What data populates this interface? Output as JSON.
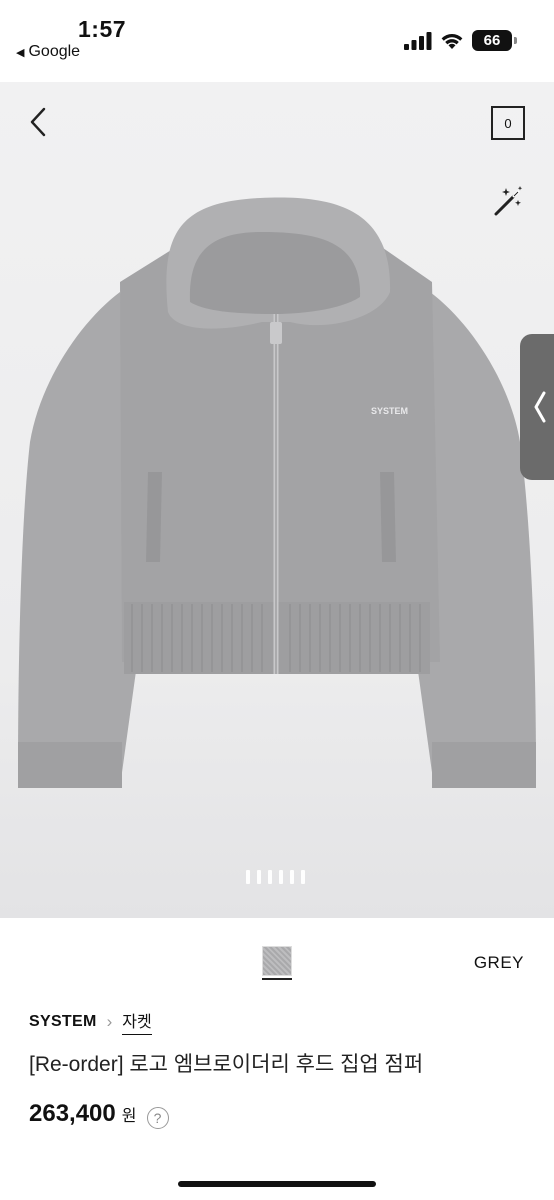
{
  "status_bar": {
    "time": "1:57",
    "back_app": "Google",
    "battery": "66"
  },
  "gallery": {
    "cart_count": "0",
    "image_alt": "Grey knit cropped zip-up hoodie with SYSTEM embroidery",
    "embroidery_text": "SYSTEM",
    "page_count": 6,
    "active_page": 1
  },
  "product": {
    "color_name": "GREY",
    "brand": "SYSTEM",
    "category": "자켓",
    "title": "[Re-order] 로고 엠브로이더리 후드 집업 점퍼",
    "price": "263,400",
    "currency": "원",
    "help_symbol": "?"
  },
  "colors": {
    "garment": "#a7a7a9",
    "background": "#ececed",
    "side_tab": "#6b6b6b"
  }
}
